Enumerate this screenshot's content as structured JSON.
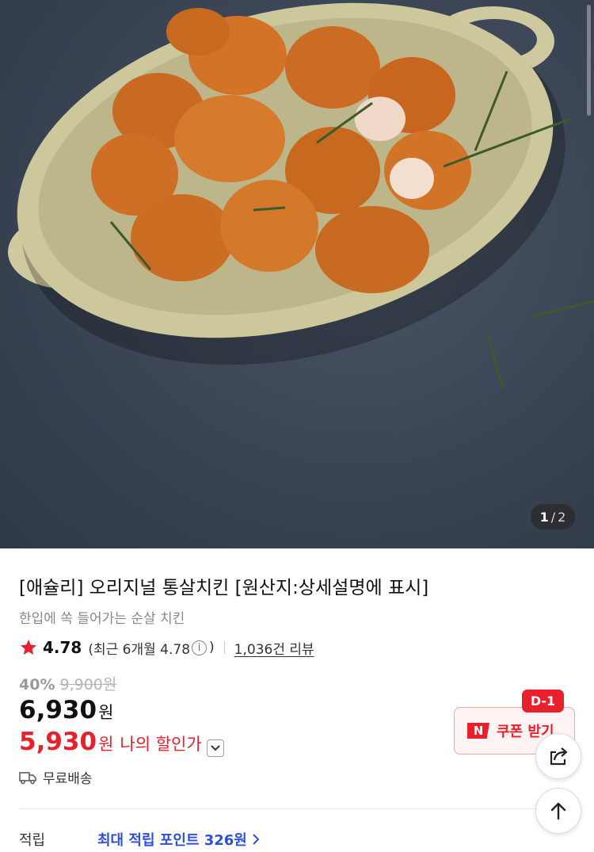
{
  "gallery": {
    "current_page": "1",
    "separator": "/",
    "total_pages": "2",
    "image_alt": "fried chicken bites in an oval dish with rosemary"
  },
  "product": {
    "title": "[애슐리] 오리지널 통살치킨 [원산지:상세설명에 표시]",
    "subtitle": "한입에 쏙 들어가는 순살 치킨",
    "rating": {
      "value": "4.78",
      "recent_text": "(최근 6개월 4.78",
      "recent_close": ")",
      "info_glyph": "i",
      "review_count_text": "1,036건 리뷰"
    },
    "pricing": {
      "discount_percent": "40%",
      "original_price": "9,900원",
      "sale_price": "6,930",
      "sale_price_unit": "원",
      "my_price": "5,930",
      "my_price_unit": "원",
      "my_price_label": "나의 할인가"
    },
    "shipping": {
      "text": "무료배송"
    },
    "points": {
      "label": "적립",
      "value": "최대 적립 포인트 326원"
    }
  },
  "coupon": {
    "brand_letter": "N",
    "label": "쿠폰 받기",
    "badge": "D-1"
  },
  "icons": {
    "star": "star-icon",
    "info": "info-icon",
    "chevron_down": "chevron-down-icon",
    "truck": "truck-icon",
    "chevron_right": "chevron-right-icon",
    "share": "share-icon",
    "arrow_up": "arrow-up-icon"
  },
  "colors": {
    "accent_red": "#e8202c",
    "points_blue": "#2f4fd8",
    "coupon_bg": "#fff3f3",
    "muted_text": "#888888"
  }
}
